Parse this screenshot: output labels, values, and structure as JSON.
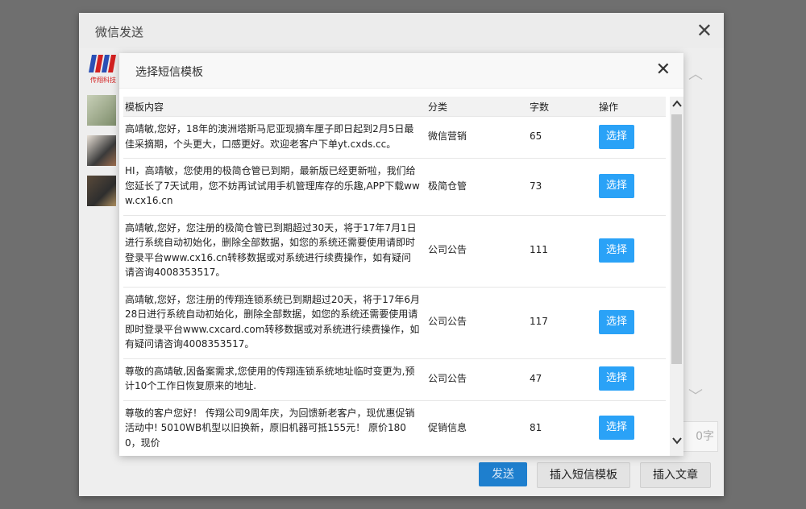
{
  "outer": {
    "title": "微信发送",
    "close_glyph": "✕",
    "logo_text": "传翔科技",
    "count_suffix": "0字",
    "send_label": "发送",
    "insert_template_label": "插入短信模板",
    "insert_article_label": "插入文章"
  },
  "modal": {
    "title": "选择短信模板",
    "close_glyph": "✕",
    "headers": {
      "content": "模板内容",
      "category": "分类",
      "count": "字数",
      "action": "操作"
    },
    "rows": [
      {
        "content": "高靖敏,您好，18年的澳洲塔斯马尼亚现摘车厘子即日起到2月5日最佳采摘期，个头更大，口感更好。欢迎老客户下单yt.cxds.cc。",
        "category": "微信营销",
        "count": "65",
        "action": "选择"
      },
      {
        "content": "HI，高靖敏，您使用的极简仓管已到期，最新版已经更新啦，我们给您延长了7天试用，您不妨再试试用手机管理库存的乐趣,APP下载www.cx16.cn",
        "category": "极简仓管",
        "count": "73",
        "action": "选择"
      },
      {
        "content": "高靖敏,您好，您注册的极简仓管已到期超过30天，将于17年7月1日进行系统自动初始化，删除全部数据，如您的系统还需要使用请即时登录平台www.cx16.cn转移数据或对系统进行续费操作，如有疑问请咨询4008353517。",
        "category": "公司公告",
        "count": "111",
        "action": "选择"
      },
      {
        "content": "高靖敏,您好，您注册的传翔连锁系统已到期超过20天，将于17年6月28日进行系统自动初始化，删除全部数据，如您的系统还需要使用请即时登录平台www.cxcard.com转移数据或对系统进行续费操作，如有疑问请咨询4008353517。",
        "category": "公司公告",
        "count": "117",
        "action": "选择"
      },
      {
        "content": "尊敬的高靖敏,因备案需求,您使用的传翔连锁系统地址临时变更为,预计10个工作日恢复原来的地址.",
        "category": "公司公告",
        "count": "47",
        "action": "选择"
      },
      {
        "content": "尊敬的客户您好！ 传翔公司9周年庆，为回馈新老客户，现优惠促销活动中! 5010WB机型以旧换新，原旧机器可抵155元！ 原价1800，现价",
        "category": "促销信息",
        "count": "81",
        "action": "选择"
      }
    ]
  }
}
